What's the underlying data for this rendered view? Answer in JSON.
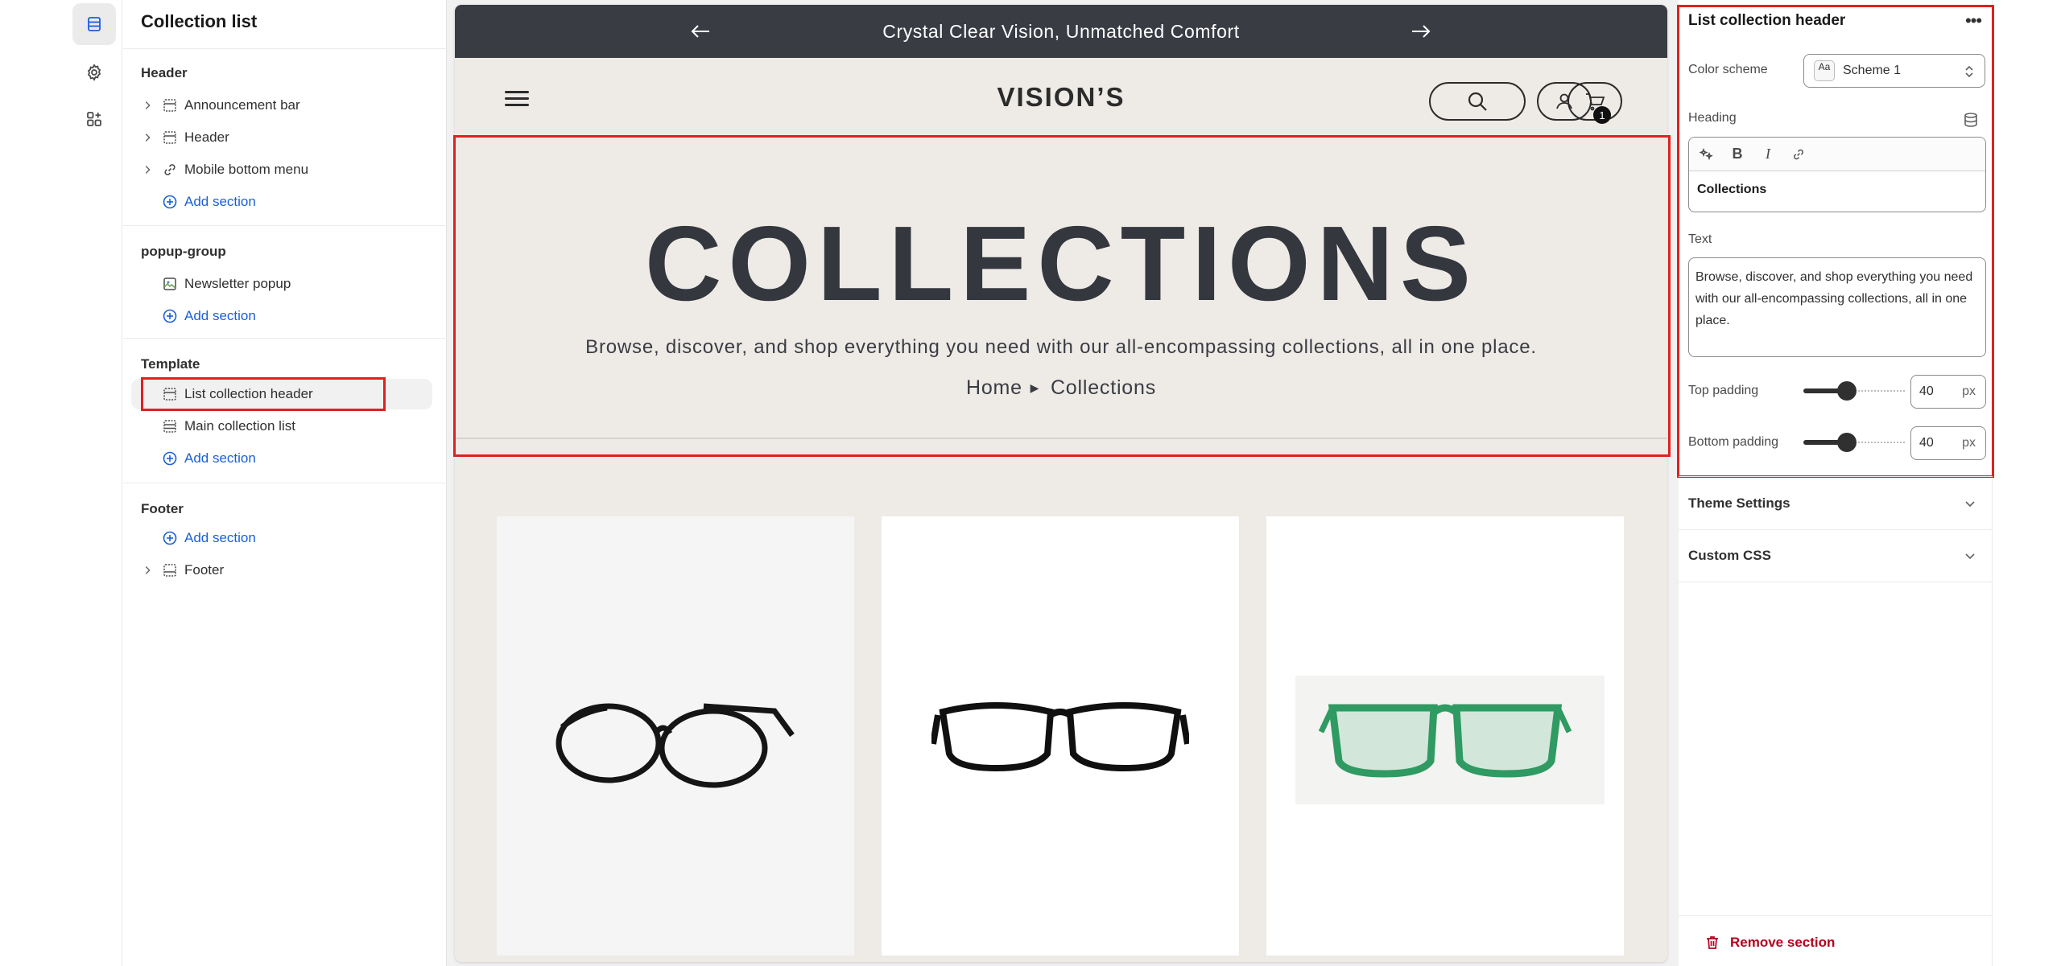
{
  "rail": {
    "items": [
      {
        "name": "sections-icon",
        "active": true
      },
      {
        "name": "settings-gear-icon",
        "active": false
      },
      {
        "name": "apps-icon",
        "active": false
      }
    ]
  },
  "sidebar": {
    "title": "Collection list",
    "groups": [
      {
        "title": "Header",
        "items": [
          {
            "label": "Announcement bar",
            "icon": "section-layout-icon",
            "expandable": true
          },
          {
            "label": "Header",
            "icon": "section-layout-icon",
            "expandable": true
          },
          {
            "label": "Mobile bottom menu",
            "icon": "link-icon",
            "expandable": true
          },
          {
            "label": "Add section",
            "icon": "plus-circle-icon",
            "add": true
          }
        ]
      },
      {
        "title": "popup-group",
        "items": [
          {
            "label": "Newsletter popup",
            "icon": "image-icon"
          },
          {
            "label": "Add section",
            "icon": "plus-circle-icon",
            "add": true
          }
        ]
      },
      {
        "title": "Template",
        "items": [
          {
            "label": "List collection header",
            "icon": "section-layout-icon",
            "selected": true
          },
          {
            "label": "Main collection list",
            "icon": "list-layout-icon"
          },
          {
            "label": "Add section",
            "icon": "plus-circle-icon",
            "add": true
          }
        ]
      },
      {
        "title": "Footer",
        "items": [
          {
            "label": "Add section",
            "icon": "plus-circle-icon",
            "add": true
          },
          {
            "label": "Footer",
            "icon": "footer-layout-icon",
            "expandable": true
          }
        ]
      }
    ]
  },
  "preview": {
    "announcement": "Crystal Clear Vision, Unmatched Comfort",
    "logo": "VISION’S",
    "cart_count": "1",
    "collections": {
      "heading": "COLLECTIONS",
      "text": "Browse, discover, and shop everything you need with our all-encompassing collections, all in one place.",
      "breadcrumb_home": "Home",
      "breadcrumb_current": "Collections"
    },
    "cards": [
      {
        "product": "black round eyeglasses"
      },
      {
        "product": "black rectangular eyeglasses"
      },
      {
        "product": "green rectangular eyeglasses"
      }
    ]
  },
  "panel": {
    "title": "List collection header",
    "color_scheme_label": "Color scheme",
    "color_scheme_value": "Scheme 1",
    "scheme_swatch": "Aa",
    "heading_label": "Heading",
    "heading_value": "Collections",
    "text_label": "Text",
    "text_value": "Browse, discover, and shop everything you need with our all-encompassing collections, all in one place.",
    "top_padding_label": "Top padding",
    "top_padding_value": "40",
    "bottom_padding_label": "Bottom padding",
    "bottom_padding_value": "40",
    "padding_unit": "px",
    "theme_settings": "Theme Settings",
    "custom_css": "Custom CSS",
    "remove": "Remove section"
  },
  "colors": {
    "accent": "#1a5fd8",
    "highlight": "#e02020",
    "announcement_bg": "#3a3c44",
    "store_bg": "#eeebe6",
    "danger": "#b5001e"
  }
}
